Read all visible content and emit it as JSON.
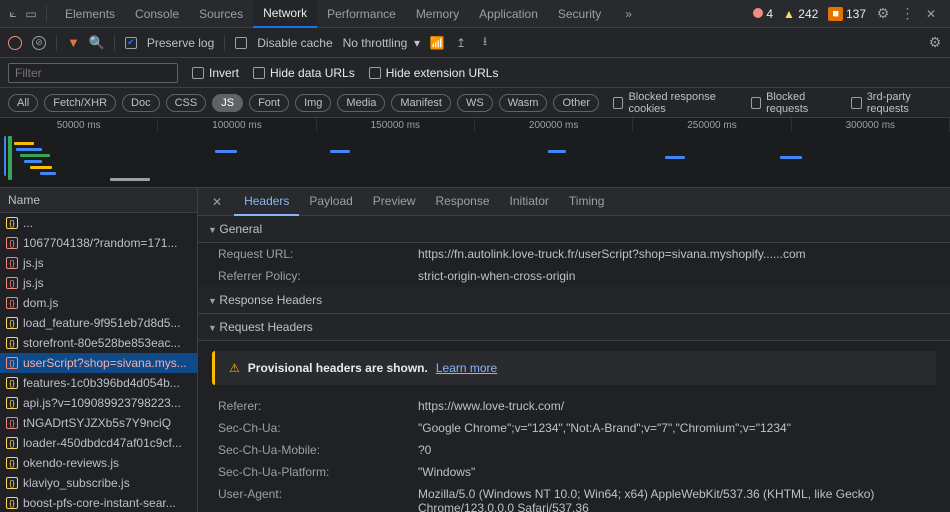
{
  "topTabs": [
    "Elements",
    "Console",
    "Sources",
    "Network",
    "Performance",
    "Memory",
    "Application",
    "Security"
  ],
  "topTabActive": 3,
  "topMore": "»",
  "errors": {
    "count": "4"
  },
  "warnings": {
    "count": "242"
  },
  "messages": {
    "count": "137"
  },
  "toolbar": {
    "preserveLog": "Preserve log",
    "disableCache": "Disable cache",
    "throttling": "No throttling"
  },
  "filterRow": {
    "placeholder": "Filter",
    "invert": "Invert",
    "hideData": "Hide data URLs",
    "hideExt": "Hide extension URLs"
  },
  "typeRow": {
    "types": [
      "All",
      "Fetch/XHR",
      "Doc",
      "CSS",
      "JS",
      "Font",
      "Img",
      "Media",
      "Manifest",
      "WS",
      "Wasm",
      "Other"
    ],
    "active": 4,
    "blockedCookies": "Blocked response cookies",
    "blockedReq": "Blocked requests",
    "thirdParty": "3rd-party requests"
  },
  "timeline": {
    "ticks": [
      "50000 ms",
      "100000 ms",
      "150000 ms",
      "200000 ms",
      "250000 ms",
      "300000 ms"
    ]
  },
  "sidebar": {
    "header": "Name",
    "rows": [
      {
        "label": "...",
        "err": false,
        "partial": true
      },
      {
        "label": "1067704138/?random=171...",
        "err": true
      },
      {
        "label": "js.js",
        "err": true
      },
      {
        "label": "js.js",
        "err": true
      },
      {
        "label": "dom.js",
        "err": true
      },
      {
        "label": "load_feature-9f951eb7d8d5...",
        "err": false
      },
      {
        "label": "storefront-80e528be853eac...",
        "err": false
      },
      {
        "label": "userScript?shop=sivana.mys...",
        "err": true,
        "sel": true
      },
      {
        "label": "features-1c0b396bd4d054b...",
        "err": false
      },
      {
        "label": "api.js?v=109089923798223...",
        "err": false
      },
      {
        "label": "tNGADrtSYJZXb5s7Y9nciQ",
        "err": true
      },
      {
        "label": "loader-450dbdcd47af01c9cf...",
        "err": false
      },
      {
        "label": "okendo-reviews.js",
        "err": false
      },
      {
        "label": "klaviyo_subscribe.js",
        "err": false
      },
      {
        "label": "boost-pfs-core-instant-sear...",
        "err": false
      }
    ]
  },
  "detail": {
    "tabs": [
      "Headers",
      "Payload",
      "Preview",
      "Response",
      "Initiator",
      "Timing"
    ],
    "tabActive": 0,
    "sections": {
      "general": "General",
      "responseHeaders": "Response Headers",
      "requestHeaders": "Request Headers"
    },
    "general": {
      "requestUrlK": "Request URL:",
      "requestUrlV": "https://fn.autolink.love-truck.fr/userScript?shop=sivana.myshopify......com",
      "refPolK": "Referrer Policy:",
      "refPolV": "strict-origin-when-cross-origin"
    },
    "banner": {
      "warn": "⚠",
      "text": "Provisional headers are shown.",
      "link": "Learn more"
    },
    "reqHeaders": [
      {
        "k": "Referer:",
        "v": "https://www.love-truck.com/"
      },
      {
        "k": "Sec-Ch-Ua:",
        "v": "\"Google Chrome\";v=\"1234\",\"Not:A-Brand\";v=\"7\",\"Chromium\";v=\"1234\""
      },
      {
        "k": "Sec-Ch-Ua-Mobile:",
        "v": "?0"
      },
      {
        "k": "Sec-Ch-Ua-Platform:",
        "v": "\"Windows\""
      },
      {
        "k": "User-Agent:",
        "v": "Mozilla/5.0 (Windows NT 10.0; Win64; x64) AppleWebKit/537.36 (KHTML, like Gecko) Chrome/123.0.0.0 Safari/537.36"
      }
    ]
  }
}
